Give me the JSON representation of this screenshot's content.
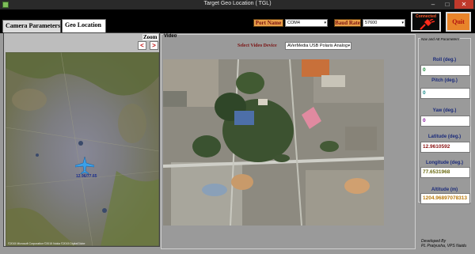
{
  "window": {
    "title": "Target Geo Location ( TGL)",
    "min_glyph": "–",
    "max_glyph": "□",
    "close_glyph": "✕"
  },
  "toolbar": {
    "port_name_label": "Port Name",
    "port_name_value": "COM4",
    "baud_rate_label": "Baud Rate",
    "baud_rate_value": "57600",
    "connection_status": "Connected",
    "quit_label": "Quit"
  },
  "tabs": [
    {
      "label": "Camera Parameters",
      "active": false
    },
    {
      "label": "Geo Location",
      "active": true
    }
  ],
  "map_panel": {
    "zoom_label": "Zoom",
    "zoom_out_glyph": "<",
    "zoom_in_glyph": ">",
    "marker_label": "12.96/77.65",
    "attribution": "©2015 Microsoft Corporation ©2015 Nokia ©2015 DigitalGlobe"
  },
  "video_panel": {
    "legend": "Video",
    "device_label": "Select Video Device",
    "device_value": "AVerMedia USB Polaris Analog"
  },
  "nav_params": {
    "legend": "Nav and Att Parameters",
    "items": [
      {
        "label": "Roll (deg.)",
        "value": "0",
        "color": "#1a8a3a"
      },
      {
        "label": "Pitch (deg.)",
        "value": "0",
        "color": "#1a8a8a"
      },
      {
        "label": "Yaw (deg.)",
        "value": "0",
        "color": "#8a1aa0"
      },
      {
        "label": "Latitude (deg.)",
        "value": "12.9610592",
        "color": "#8a1010"
      },
      {
        "label": "Longitude (deg.)",
        "value": "77.6531968",
        "color": "#6a6a10"
      },
      {
        "label": "Altitude (m)",
        "value": "1204.96897078313",
        "color": "#b8780a"
      }
    ]
  },
  "footer": {
    "developed_by": "Developed By",
    "authors": "PL Pratyusha, VPS Naidu"
  },
  "colors": {
    "label_box_bg": "#e9a04a",
    "label_box_text": "#7a1010",
    "quit_bg": "#e8842a",
    "param_label": "#1a2a7a"
  }
}
